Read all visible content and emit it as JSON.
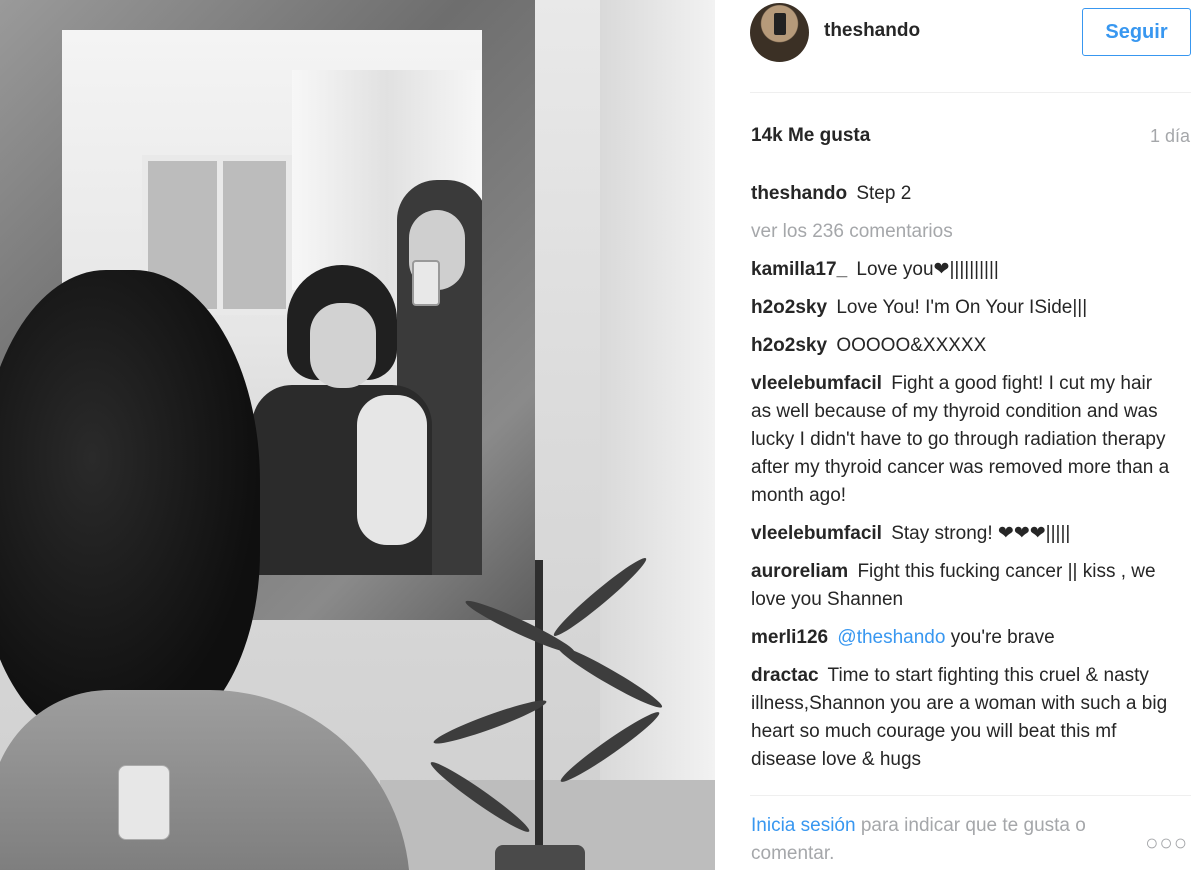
{
  "post": {
    "username": "theshando",
    "follow_label": "Seguir",
    "likes": "14k Me gusta",
    "time_ago": "1 día",
    "caption": {
      "user": "theshando",
      "text": "Step 2"
    },
    "view_all_comments": "ver los 236 comentarios",
    "comments": [
      {
        "user": "kamilla17_",
        "text": "Love you❤||||||||||"
      },
      {
        "user": "h2o2sky",
        "text": "Love You! I'm On Your ISide|||"
      },
      {
        "user": "h2o2sky",
        "text": "OOOOO&XXXXX"
      },
      {
        "user": "vleelebumfacil",
        "text": "Fight a good fight! I cut my hair as well because of my thyroid condition and was lucky I didn't have to go through radiation therapy after my thyroid cancer was removed more than a month ago!"
      },
      {
        "user": "vleelebumfacil",
        "text": "Stay strong! ❤❤❤|||||"
      },
      {
        "user": "auroreliam",
        "text": "Fight this fucking cancer || kiss , we love you Shannen"
      },
      {
        "user": "merli126",
        "mention": "@theshando",
        "text": "you're brave"
      },
      {
        "user": "dractac",
        "text": "Time to start fighting this cruel & nasty illness,Shannon you are a woman with such a big heart so much courage you will beat this mf disease love & hugs"
      }
    ],
    "footer": {
      "login_link": "Inicia sesión",
      "rest": "para indicar que te gusta o comentar."
    },
    "more_icon": "more-options-icon",
    "more_glyph": "○○○",
    "accent_color": "#3897f0",
    "muted_color": "#a5a7aa"
  }
}
